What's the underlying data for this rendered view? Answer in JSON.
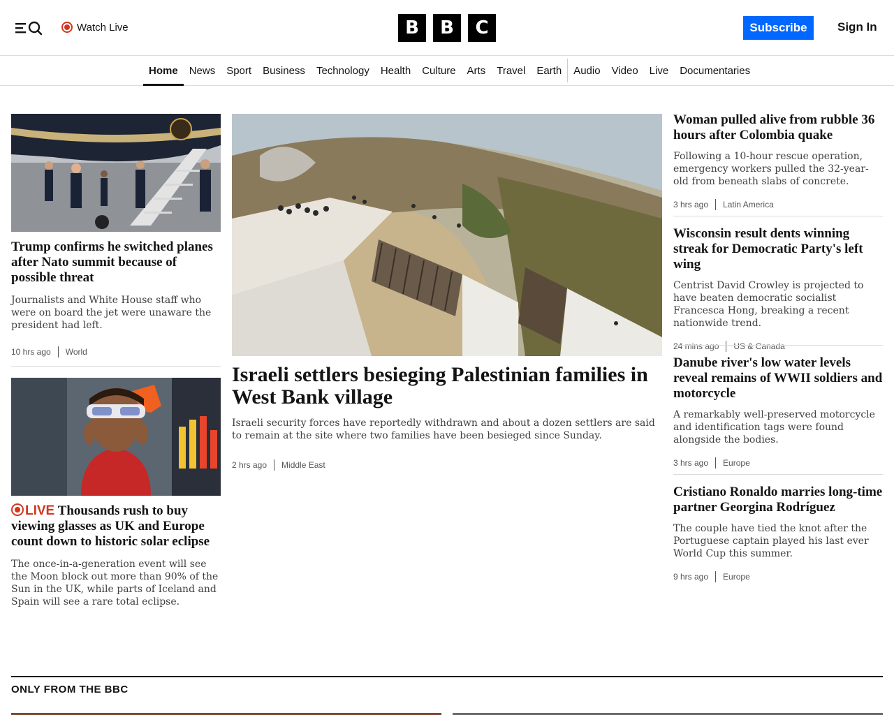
{
  "header": {
    "watch_live": "Watch Live",
    "logo_letters": [
      "B",
      "B",
      "C"
    ],
    "subscribe": "Subscribe",
    "sign_in": "Sign In"
  },
  "nav": {
    "items": [
      "Home",
      "News",
      "Sport",
      "Business",
      "Technology",
      "Health",
      "Culture",
      "Arts",
      "Travel",
      "Earth",
      "Audio",
      "Video",
      "Live",
      "Documentaries"
    ],
    "active": "Home"
  },
  "stories": {
    "trump": {
      "headline": "Trump confirms he switched planes after Nato summit because of possible threat",
      "summary": "Journalists and White House staff who were on board the jet were unaware the president had left.",
      "time": "10 hrs ago",
      "category": "World"
    },
    "eclipse": {
      "live_label": "LIVE",
      "headline": "Thousands rush to buy viewing glasses as UK and Europe count down to historic solar eclipse",
      "summary": "The once-in-a-generation event will see the Moon block out more than 90% of the Sun in the UK, while parts of Iceland and Spain will see a rare total eclipse."
    },
    "lead": {
      "headline": "Israeli settlers besieging Palestinian families in West Bank village",
      "summary": "Israeli security forces have reportedly withdrawn and about a dozen settlers are said to remain at the site where two families have been besieged since Sunday.",
      "time": "2 hrs ago",
      "category": "Middle East"
    },
    "colombia": {
      "headline": "Woman pulled alive from rubble 36 hours after Colombia quake",
      "summary": "Following a 10-hour rescue operation, emergency workers pulled the 32-year-old from beneath slabs of concrete.",
      "time": "3 hrs ago",
      "category": "Latin America"
    },
    "wisconsin": {
      "headline": "Wisconsin result dents winning streak for Democratic Party's left wing",
      "summary": "Centrist David Crowley is projected to have beaten democratic socialist Francesca Hong, breaking a recent nationwide trend.",
      "time": "24 mins ago",
      "category": "US & Canada"
    },
    "danube": {
      "headline": "Danube river's low water levels reveal remains of WWII soldiers and motorcycle",
      "summary": "A remarkably well-preserved motorcycle and identification tags were found alongside the bodies.",
      "time": "3 hrs ago",
      "category": "Europe"
    },
    "ronaldo": {
      "headline": "Cristiano Ronaldo marries long-time partner Georgina Rodríguez",
      "summary": "The couple have tied the knot after the Portuguese captain played his last ever World Cup this summer.",
      "time": "9 hrs ago",
      "category": "Europe"
    }
  },
  "sections": {
    "only_from_bbc": "ONLY FROM THE BBC"
  },
  "colors": {
    "brand_black": "#000000",
    "subscribe_blue": "#0068ff",
    "live_red": "#d4351c"
  }
}
